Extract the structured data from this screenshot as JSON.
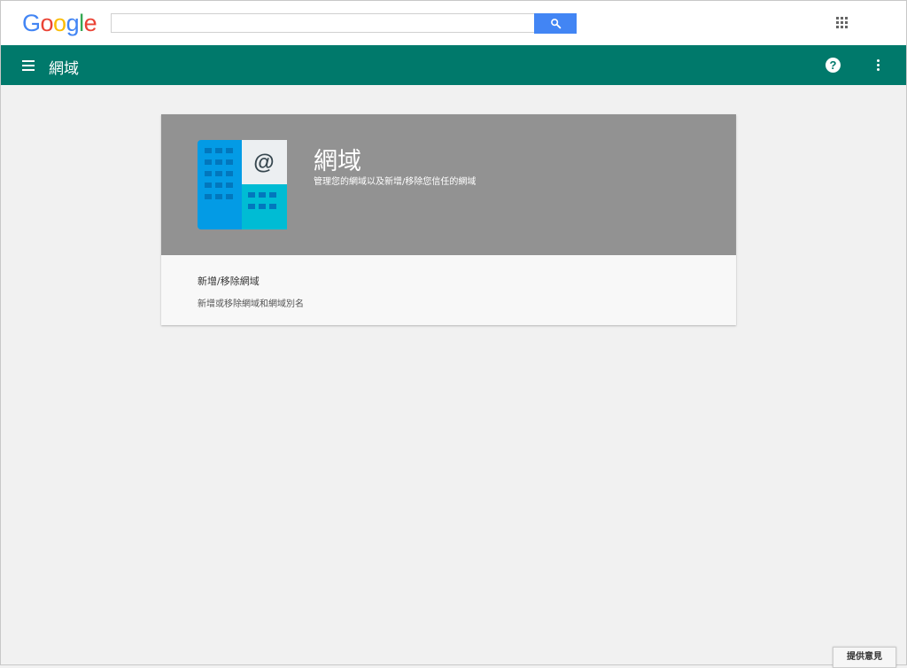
{
  "header": {
    "logo_letters": [
      "G",
      "o",
      "o",
      "g",
      "l",
      "e"
    ],
    "logo_colors": [
      "#4285f4",
      "#ea4335",
      "#fbbc05",
      "#4285f4",
      "#34a853",
      "#ea4335"
    ],
    "search": {
      "value": "",
      "placeholder": ""
    },
    "search_button_icon": "search-icon",
    "apps_icon": "apps-grid-icon",
    "accent_color": "#4285f4"
  },
  "appbar": {
    "title": "網域",
    "color": "#00796b",
    "menu_icon": "menu-icon",
    "help_icon": "help-icon",
    "more_icon": "more-vert-icon"
  },
  "card": {
    "title": "網域",
    "subtitle": "管理您的網域以及新增/移除您信任的網域",
    "icon": "domains-icon",
    "icon_symbol": "@",
    "link_label": "新增/移除網域",
    "link_description": "新增或移除網域和網域別名"
  },
  "footer": {
    "feedback_label": "提供意見"
  }
}
